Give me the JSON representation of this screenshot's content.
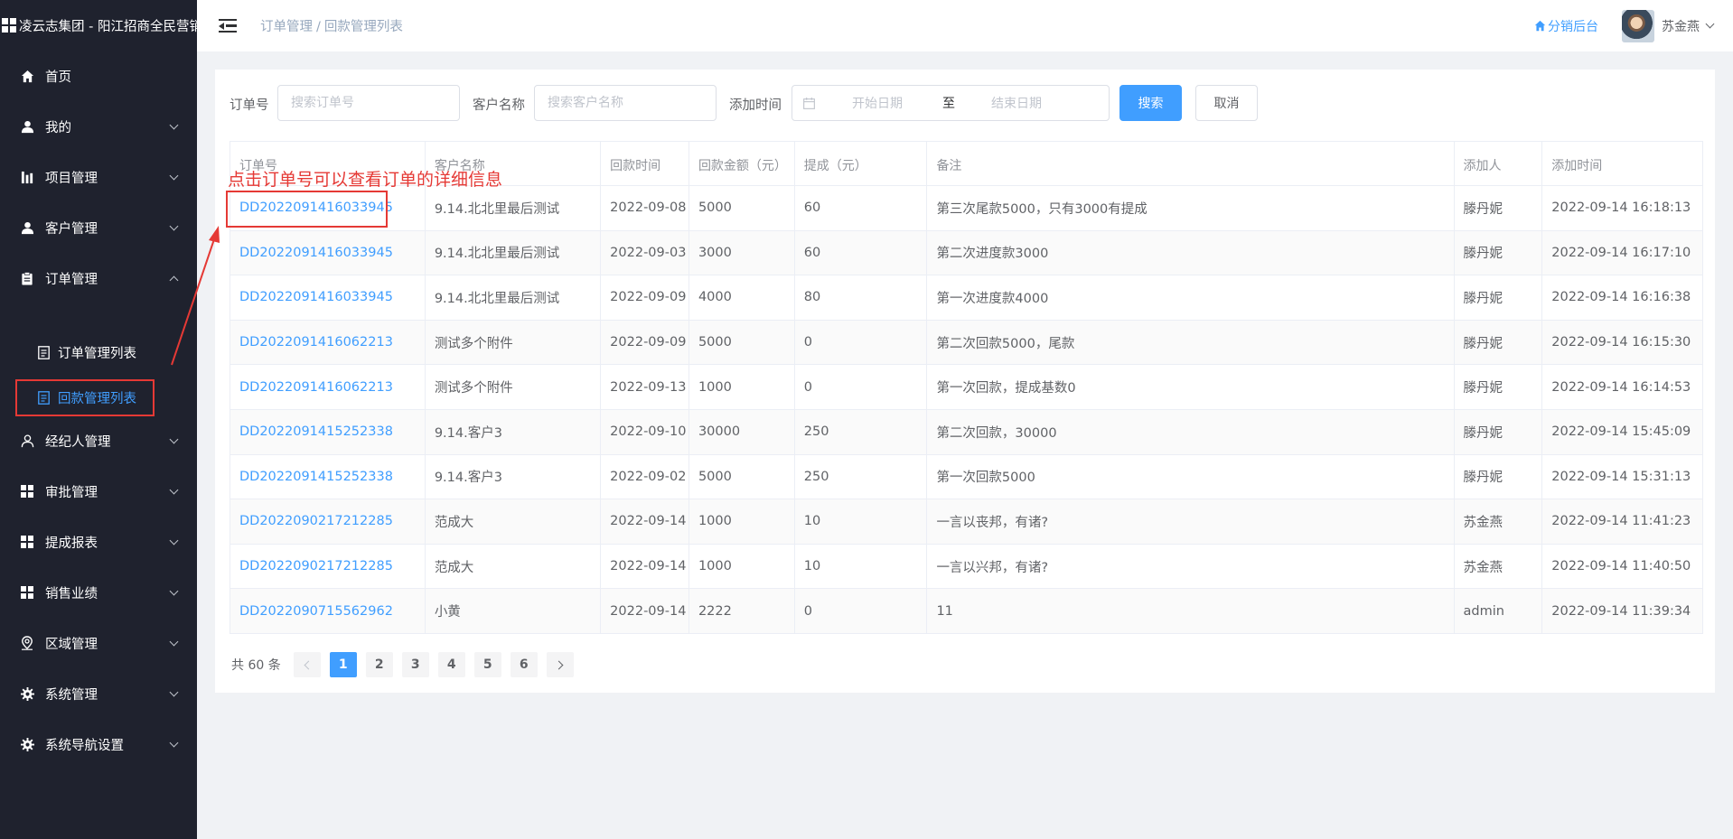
{
  "app": {
    "title": "凌云志集团 - 阳江招商全民营销"
  },
  "sidebar": {
    "items": [
      {
        "label": "首页",
        "icon": "home-icon"
      },
      {
        "label": "我的",
        "icon": "user-icon"
      },
      {
        "label": "项目管理",
        "icon": "chart-icon"
      },
      {
        "label": "客户管理",
        "icon": "user-icon"
      },
      {
        "label": "订单管理",
        "icon": "clipboard-icon",
        "expanded": true
      }
    ],
    "order_submenu": [
      {
        "label": "订单管理列表"
      },
      {
        "label": "回款管理列表",
        "active": true
      }
    ],
    "items_after": [
      {
        "label": "经纪人管理",
        "icon": "user-outline-icon"
      },
      {
        "label": "审批管理",
        "icon": "grid-icon"
      },
      {
        "label": "提成报表",
        "icon": "grid-icon"
      },
      {
        "label": "销售业绩",
        "icon": "grid-icon"
      },
      {
        "label": "区域管理",
        "icon": "location-icon"
      },
      {
        "label": "系统管理",
        "icon": "gear-icon"
      },
      {
        "label": "系统导航设置",
        "icon": "gear-icon"
      }
    ]
  },
  "header": {
    "breadcrumb": [
      "订单管理",
      "回款管理列表"
    ],
    "breadcrumb_sep": "/",
    "home_link": "分销后台",
    "user_name": "苏金燕"
  },
  "filters": {
    "order_no_label": "订单号",
    "order_no_placeholder": "搜索订单号",
    "customer_label": "客户名称",
    "customer_placeholder": "搜索客户名称",
    "date_label": "添加时间",
    "date_start_placeholder": "开始日期",
    "date_sep": "至",
    "date_end_placeholder": "结束日期",
    "search_button": "搜索",
    "cancel_button": "取消"
  },
  "annotation": {
    "text": "点击订单号可以查看订单的详细信息"
  },
  "table": {
    "columns": [
      "订单号",
      "客户名称",
      "回款时间",
      "回款金额（元）",
      "提成（元）",
      "备注",
      "添加人",
      "添加时间"
    ],
    "rows": [
      [
        "DD2022091416033945",
        "9.14.北北里最后测试",
        "2022-09-08",
        "5000",
        "60",
        "第三次尾款5000，只有3000有提成",
        "滕丹妮",
        "2022-09-14 16:18:13"
      ],
      [
        "DD2022091416033945",
        "9.14.北北里最后测试",
        "2022-09-03",
        "3000",
        "60",
        "第二次进度款3000",
        "滕丹妮",
        "2022-09-14 16:17:10"
      ],
      [
        "DD2022091416033945",
        "9.14.北北里最后测试",
        "2022-09-09",
        "4000",
        "80",
        "第一次进度款4000",
        "滕丹妮",
        "2022-09-14 16:16:38"
      ],
      [
        "DD2022091416062213",
        "测试多个附件",
        "2022-09-09",
        "5000",
        "0",
        "第二次回款5000，尾款",
        "滕丹妮",
        "2022-09-14 16:15:30"
      ],
      [
        "DD2022091416062213",
        "测试多个附件",
        "2022-09-13",
        "1000",
        "0",
        "第一次回款，提成基数0",
        "滕丹妮",
        "2022-09-14 16:14:53"
      ],
      [
        "DD2022091415252338",
        "9.14.客户3",
        "2022-09-10",
        "30000",
        "250",
        "第二次回款，30000",
        "滕丹妮",
        "2022-09-14 15:45:09"
      ],
      [
        "DD2022091415252338",
        "9.14.客户3",
        "2022-09-02",
        "5000",
        "250",
        "第一次回款5000",
        "滕丹妮",
        "2022-09-14 15:31:13"
      ],
      [
        "DD2022090217212285",
        "范成大",
        "2022-09-14",
        "1000",
        "10",
        "一言以丧邦，有诸?",
        "苏金燕",
        "2022-09-14 11:41:23"
      ],
      [
        "DD2022090217212285",
        "范成大",
        "2022-09-14",
        "1000",
        "10",
        "一言以兴邦，有诸?",
        "苏金燕",
        "2022-09-14 11:40:50"
      ],
      [
        "DD2022090715562962",
        "小黄",
        "2022-09-14",
        "2222",
        "0",
        "11",
        "admin",
        "2022-09-14 11:39:34"
      ]
    ]
  },
  "pagination": {
    "total_text": "共 60 条",
    "pages": [
      "1",
      "2",
      "3",
      "4",
      "5",
      "6"
    ],
    "current": "1"
  },
  "colors": {
    "sidebar_bg": "#1f222e",
    "accent": "#409eff",
    "annotation_red": "#e53935",
    "page_bg": "#f0f2f5"
  }
}
